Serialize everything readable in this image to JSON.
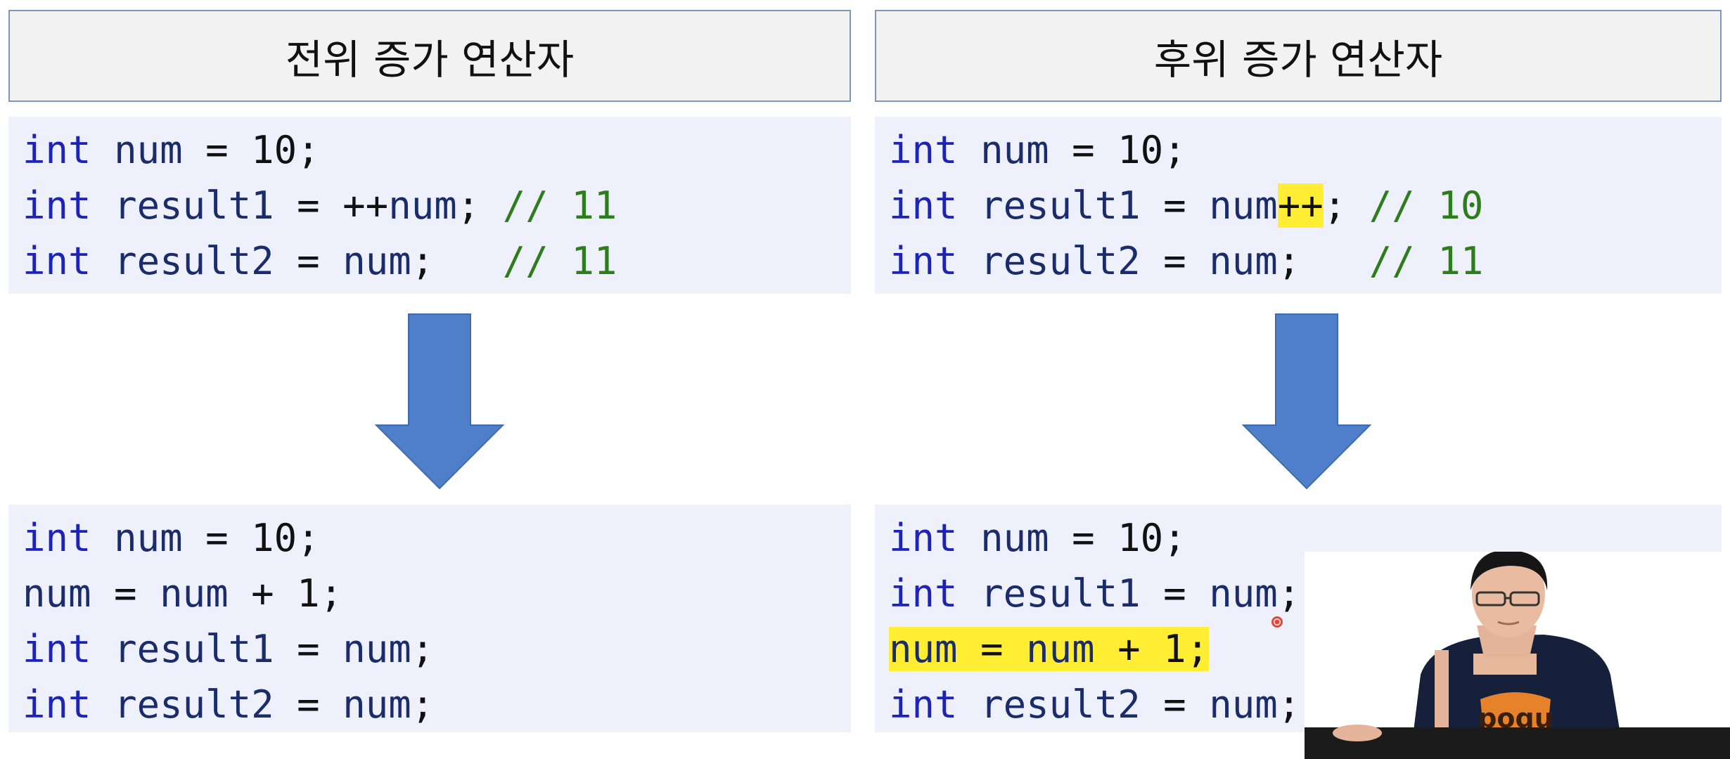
{
  "titles": {
    "left": "전위 증가 연산자",
    "right": "후위 증가 연산자"
  },
  "code_top_left": [
    [
      {
        "t": "int",
        "c": "kw"
      },
      {
        "t": " ",
        "c": "op"
      },
      {
        "t": "num",
        "c": "id"
      },
      {
        "t": " = 10;",
        "c": "op"
      }
    ],
    [
      {
        "t": "int",
        "c": "kw"
      },
      {
        "t": " ",
        "c": "op"
      },
      {
        "t": "result1",
        "c": "id"
      },
      {
        "t": " = ++",
        "c": "op"
      },
      {
        "t": "num",
        "c": "id"
      },
      {
        "t": "; ",
        "c": "op"
      },
      {
        "t": "// 11",
        "c": "cm"
      }
    ],
    [
      {
        "t": "int",
        "c": "kw"
      },
      {
        "t": " ",
        "c": "op"
      },
      {
        "t": "result2",
        "c": "id"
      },
      {
        "t": " = ",
        "c": "op"
      },
      {
        "t": "num",
        "c": "id"
      },
      {
        "t": ";   ",
        "c": "op"
      },
      {
        "t": "// 11",
        "c": "cm"
      }
    ]
  ],
  "code_top_right": [
    [
      {
        "t": "int",
        "c": "kw"
      },
      {
        "t": " ",
        "c": "op"
      },
      {
        "t": "num",
        "c": "id"
      },
      {
        "t": " = 10;",
        "c": "op"
      }
    ],
    [
      {
        "t": "int",
        "c": "kw"
      },
      {
        "t": " ",
        "c": "op"
      },
      {
        "t": "result1",
        "c": "id"
      },
      {
        "t": " = ",
        "c": "op"
      },
      {
        "t": "num",
        "c": "id"
      },
      {
        "t": "++",
        "c": "op hl"
      },
      {
        "t": "; ",
        "c": "op"
      },
      {
        "t": "// 10",
        "c": "cm"
      }
    ],
    [
      {
        "t": "int",
        "c": "kw"
      },
      {
        "t": " ",
        "c": "op"
      },
      {
        "t": "result2",
        "c": "id"
      },
      {
        "t": " = ",
        "c": "op"
      },
      {
        "t": "num",
        "c": "id"
      },
      {
        "t": ";   ",
        "c": "op"
      },
      {
        "t": "// 11",
        "c": "cm"
      }
    ]
  ],
  "code_bottom_left": [
    [
      {
        "t": "int",
        "c": "kw"
      },
      {
        "t": " ",
        "c": "op"
      },
      {
        "t": "num",
        "c": "id"
      },
      {
        "t": " = 10;",
        "c": "op"
      }
    ],
    [
      {
        "t": "num",
        "c": "id"
      },
      {
        "t": " = ",
        "c": "op"
      },
      {
        "t": "num",
        "c": "id"
      },
      {
        "t": " + 1;",
        "c": "op"
      }
    ],
    [
      {
        "t": "int",
        "c": "kw"
      },
      {
        "t": " ",
        "c": "op"
      },
      {
        "t": "result1",
        "c": "id"
      },
      {
        "t": " = ",
        "c": "op"
      },
      {
        "t": "num",
        "c": "id"
      },
      {
        "t": ";",
        "c": "op"
      }
    ],
    [
      {
        "t": "int",
        "c": "kw"
      },
      {
        "t": " ",
        "c": "op"
      },
      {
        "t": "result2",
        "c": "id"
      },
      {
        "t": " = ",
        "c": "op"
      },
      {
        "t": "num",
        "c": "id"
      },
      {
        "t": ";",
        "c": "op"
      }
    ]
  ],
  "code_bottom_right": [
    [
      {
        "t": "int",
        "c": "kw"
      },
      {
        "t": " ",
        "c": "op"
      },
      {
        "t": "num",
        "c": "id"
      },
      {
        "t": " = 10;",
        "c": "op"
      }
    ],
    [
      {
        "t": "int",
        "c": "kw"
      },
      {
        "t": " ",
        "c": "op"
      },
      {
        "t": "result1",
        "c": "id"
      },
      {
        "t": " = ",
        "c": "op"
      },
      {
        "t": "num",
        "c": "id"
      },
      {
        "t": ";",
        "c": "op"
      }
    ],
    [
      {
        "t": "num",
        "c": "id hl"
      },
      {
        "t": " = ",
        "c": "op hl"
      },
      {
        "t": "num",
        "c": "id hl"
      },
      {
        "t": " + 1;",
        "c": "op hl"
      }
    ],
    [
      {
        "t": "int",
        "c": "kw"
      },
      {
        "t": " ",
        "c": "op"
      },
      {
        "t": "result2",
        "c": "id"
      },
      {
        "t": " = ",
        "c": "op"
      },
      {
        "t": "num",
        "c": "id"
      },
      {
        "t": ";",
        "c": "op"
      }
    ]
  ],
  "shirt_logo_text": "poqu",
  "colors": {
    "arrow": "#4f7fc8",
    "highlight": "#ffee33",
    "keyword": "#1c23b8",
    "comment": "#2e7d1c",
    "code_bg": "#eef1fb"
  }
}
